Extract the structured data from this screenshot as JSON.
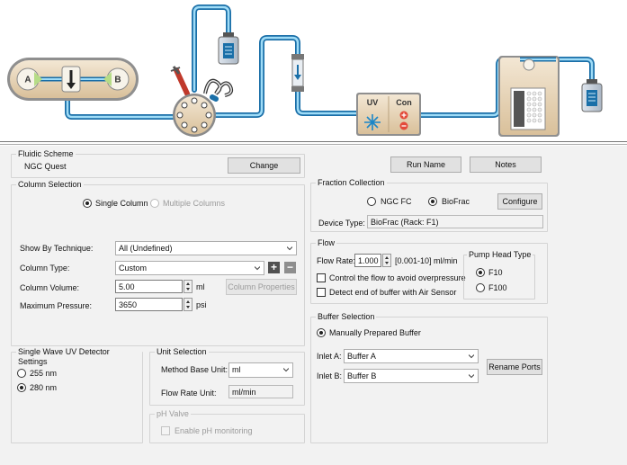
{
  "scheme": {
    "inlet_a_label": "A",
    "inlet_b_label": "B",
    "uv_label": "UV",
    "con_label": "Con"
  },
  "fluidic_scheme": {
    "title": "Fluidic Scheme",
    "value": "NGC Quest",
    "change_label": "Change"
  },
  "top_buttons": {
    "run_name": "Run Name",
    "notes": "Notes"
  },
  "column_selection": {
    "title": "Column Selection",
    "single_column": "Single Column",
    "multiple_columns": "Multiple Columns",
    "show_by_technique_label": "Show By Technique:",
    "show_by_technique_value": "All (Undefined)",
    "column_type_label": "Column Type:",
    "column_type_value": "Custom",
    "add_icon": "+",
    "remove_icon": "−",
    "column_volume_label": "Column Volume:",
    "column_volume_value": "5.00",
    "column_volume_unit": "ml",
    "column_properties_label": "Column Properties",
    "max_pressure_label": "Maximum Pressure:",
    "max_pressure_value": "3650",
    "max_pressure_unit": "psi"
  },
  "uv_detector": {
    "title": "Single Wave UV Detector Settings",
    "option1": "255 nm",
    "option2": "280 nm"
  },
  "unit_selection": {
    "title": "Unit Selection",
    "method_base_unit_label": "Method Base Unit:",
    "method_base_unit_value": "ml",
    "flow_rate_unit_label": "Flow Rate Unit:",
    "flow_rate_unit_value": "ml/min"
  },
  "ph_valve": {
    "title": "pH Valve",
    "enable_label": "Enable pH monitoring"
  },
  "fraction_collection": {
    "title": "Fraction Collection",
    "ngc_fc": "NGC FC",
    "biofrac": "BioFrac",
    "configure_label": "Configure",
    "device_type_label": "Device Type:",
    "device_type_value": "BioFrac (Rack: F1)"
  },
  "flow": {
    "title": "Flow",
    "flow_rate_label": "Flow Rate:",
    "flow_rate_value": "1.000",
    "flow_rate_range": "[0.001-10] ml/min",
    "control_flow_label": "Control the flow to avoid overpressure",
    "detect_end_label": "Detect end of buffer with Air Sensor"
  },
  "pump_head": {
    "title": "Pump Head Type",
    "f10": "F10",
    "f100": "F100"
  },
  "buffer_selection": {
    "title": "Buffer Selection",
    "manually_prepared": "Manually Prepared Buffer",
    "inlet_a_label": "Inlet A:",
    "inlet_a_value": "Buffer A",
    "inlet_b_label": "Inlet B:",
    "inlet_b_value": "Buffer B",
    "rename_ports_label": "Rename Ports"
  },
  "colors": {
    "tubing": "#1a86c8",
    "tubing_highlight": "#8fd3f5",
    "module_fill": "#ead8bd",
    "panel_bg": "#f2f2f2"
  }
}
